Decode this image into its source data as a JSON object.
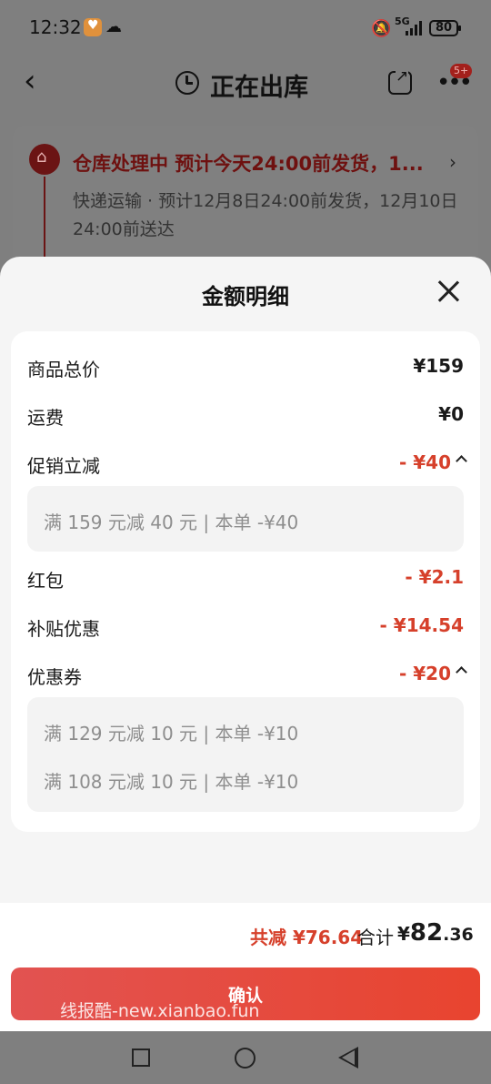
{
  "status_bar": {
    "time": "12:32",
    "network": "5G",
    "battery": "80"
  },
  "nav": {
    "title": "正在出库",
    "badge": "5+"
  },
  "status_card": {
    "title": "仓库处理中  预计今天24:00前发货，1...",
    "description": "快递运输 · 预计12月8日24:00前发货，12月10日24:00前送达"
  },
  "sheet": {
    "title": "金额明细",
    "rows": {
      "goods_total": {
        "label": "商品总价",
        "value": "¥159"
      },
      "shipping": {
        "label": "运费",
        "value": "¥0"
      },
      "promo": {
        "label": "促销立减",
        "value": "- ¥40"
      },
      "red_packet": {
        "label": "红包",
        "value": "- ¥2.1"
      },
      "subsidy": {
        "label": "补贴优惠",
        "value": "- ¥14.54"
      },
      "coupon": {
        "label": "优惠券",
        "value": "- ¥20"
      }
    },
    "promo_details": [
      "满 159 元减 40 元 | 本单 -¥40"
    ],
    "coupon_details": [
      "满 129 元减 10 元 | 本单 -¥10",
      "满 108 元减 10 元 | 本单 -¥10"
    ]
  },
  "summary": {
    "total_saved": "共减 ¥76.64",
    "total_label": "合计",
    "currency": "¥",
    "total_int": "82",
    "total_dec": ".36"
  },
  "confirm_label": "确认",
  "watermark": "线报酷-new.xianbao.fun",
  "colors": {
    "accent_red": "#d6402b",
    "button_start": "#e25351",
    "button_end": "#e8442f",
    "overlay": "#7f7f7f"
  }
}
